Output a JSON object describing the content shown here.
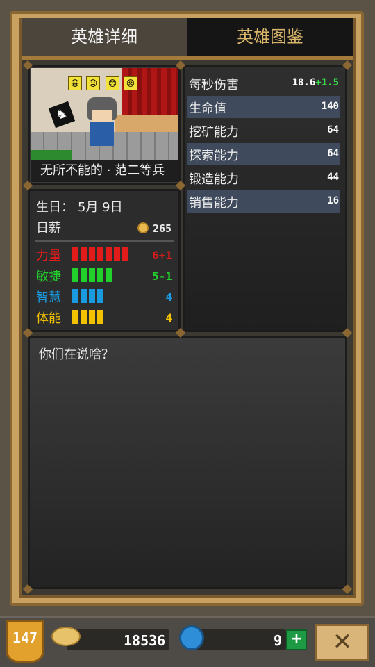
{
  "tabs": {
    "details": "英雄详细",
    "codex": "英雄图鉴"
  },
  "hero": {
    "name": "无所不能的 · 范二等兵",
    "birthday_label": "生日：",
    "birthday_value": "5月 9日",
    "salary_label": "日薪",
    "salary_value": "265"
  },
  "attributes": [
    {
      "label": "力量",
      "value": "6+1",
      "level": 7,
      "color": "#e21b1b"
    },
    {
      "label": "敏捷",
      "value": "5-1",
      "level": 5,
      "color": "#22d02b"
    },
    {
      "label": "智慧",
      "value": "4",
      "level": 4,
      "color": "#1a9be0"
    },
    {
      "label": "体能",
      "value": "4",
      "level": 4,
      "color": "#f2c200"
    }
  ],
  "stats": [
    {
      "label": "每秒伤害",
      "value": "18.6",
      "bonus": "+1.5"
    },
    {
      "label": "生命值",
      "value": "140"
    },
    {
      "label": "挖矿能力",
      "value": "64"
    },
    {
      "label": "探索能力",
      "value": "64"
    },
    {
      "label": "锻造能力",
      "value": "44"
    },
    {
      "label": "销售能力",
      "value": "16"
    }
  ],
  "quote": "你们在说啥？",
  "bottom": {
    "level": "147",
    "gold": "18536",
    "gems": "9",
    "plus": "+",
    "close": "✕"
  },
  "icons": {
    "mood": [
      "😀",
      "😐",
      "😊",
      "😠"
    ],
    "flag": "♞"
  },
  "colors": {
    "frame": "#c9a262",
    "bonus_green": "#38e04a",
    "attr_red": "#e21b1b"
  }
}
